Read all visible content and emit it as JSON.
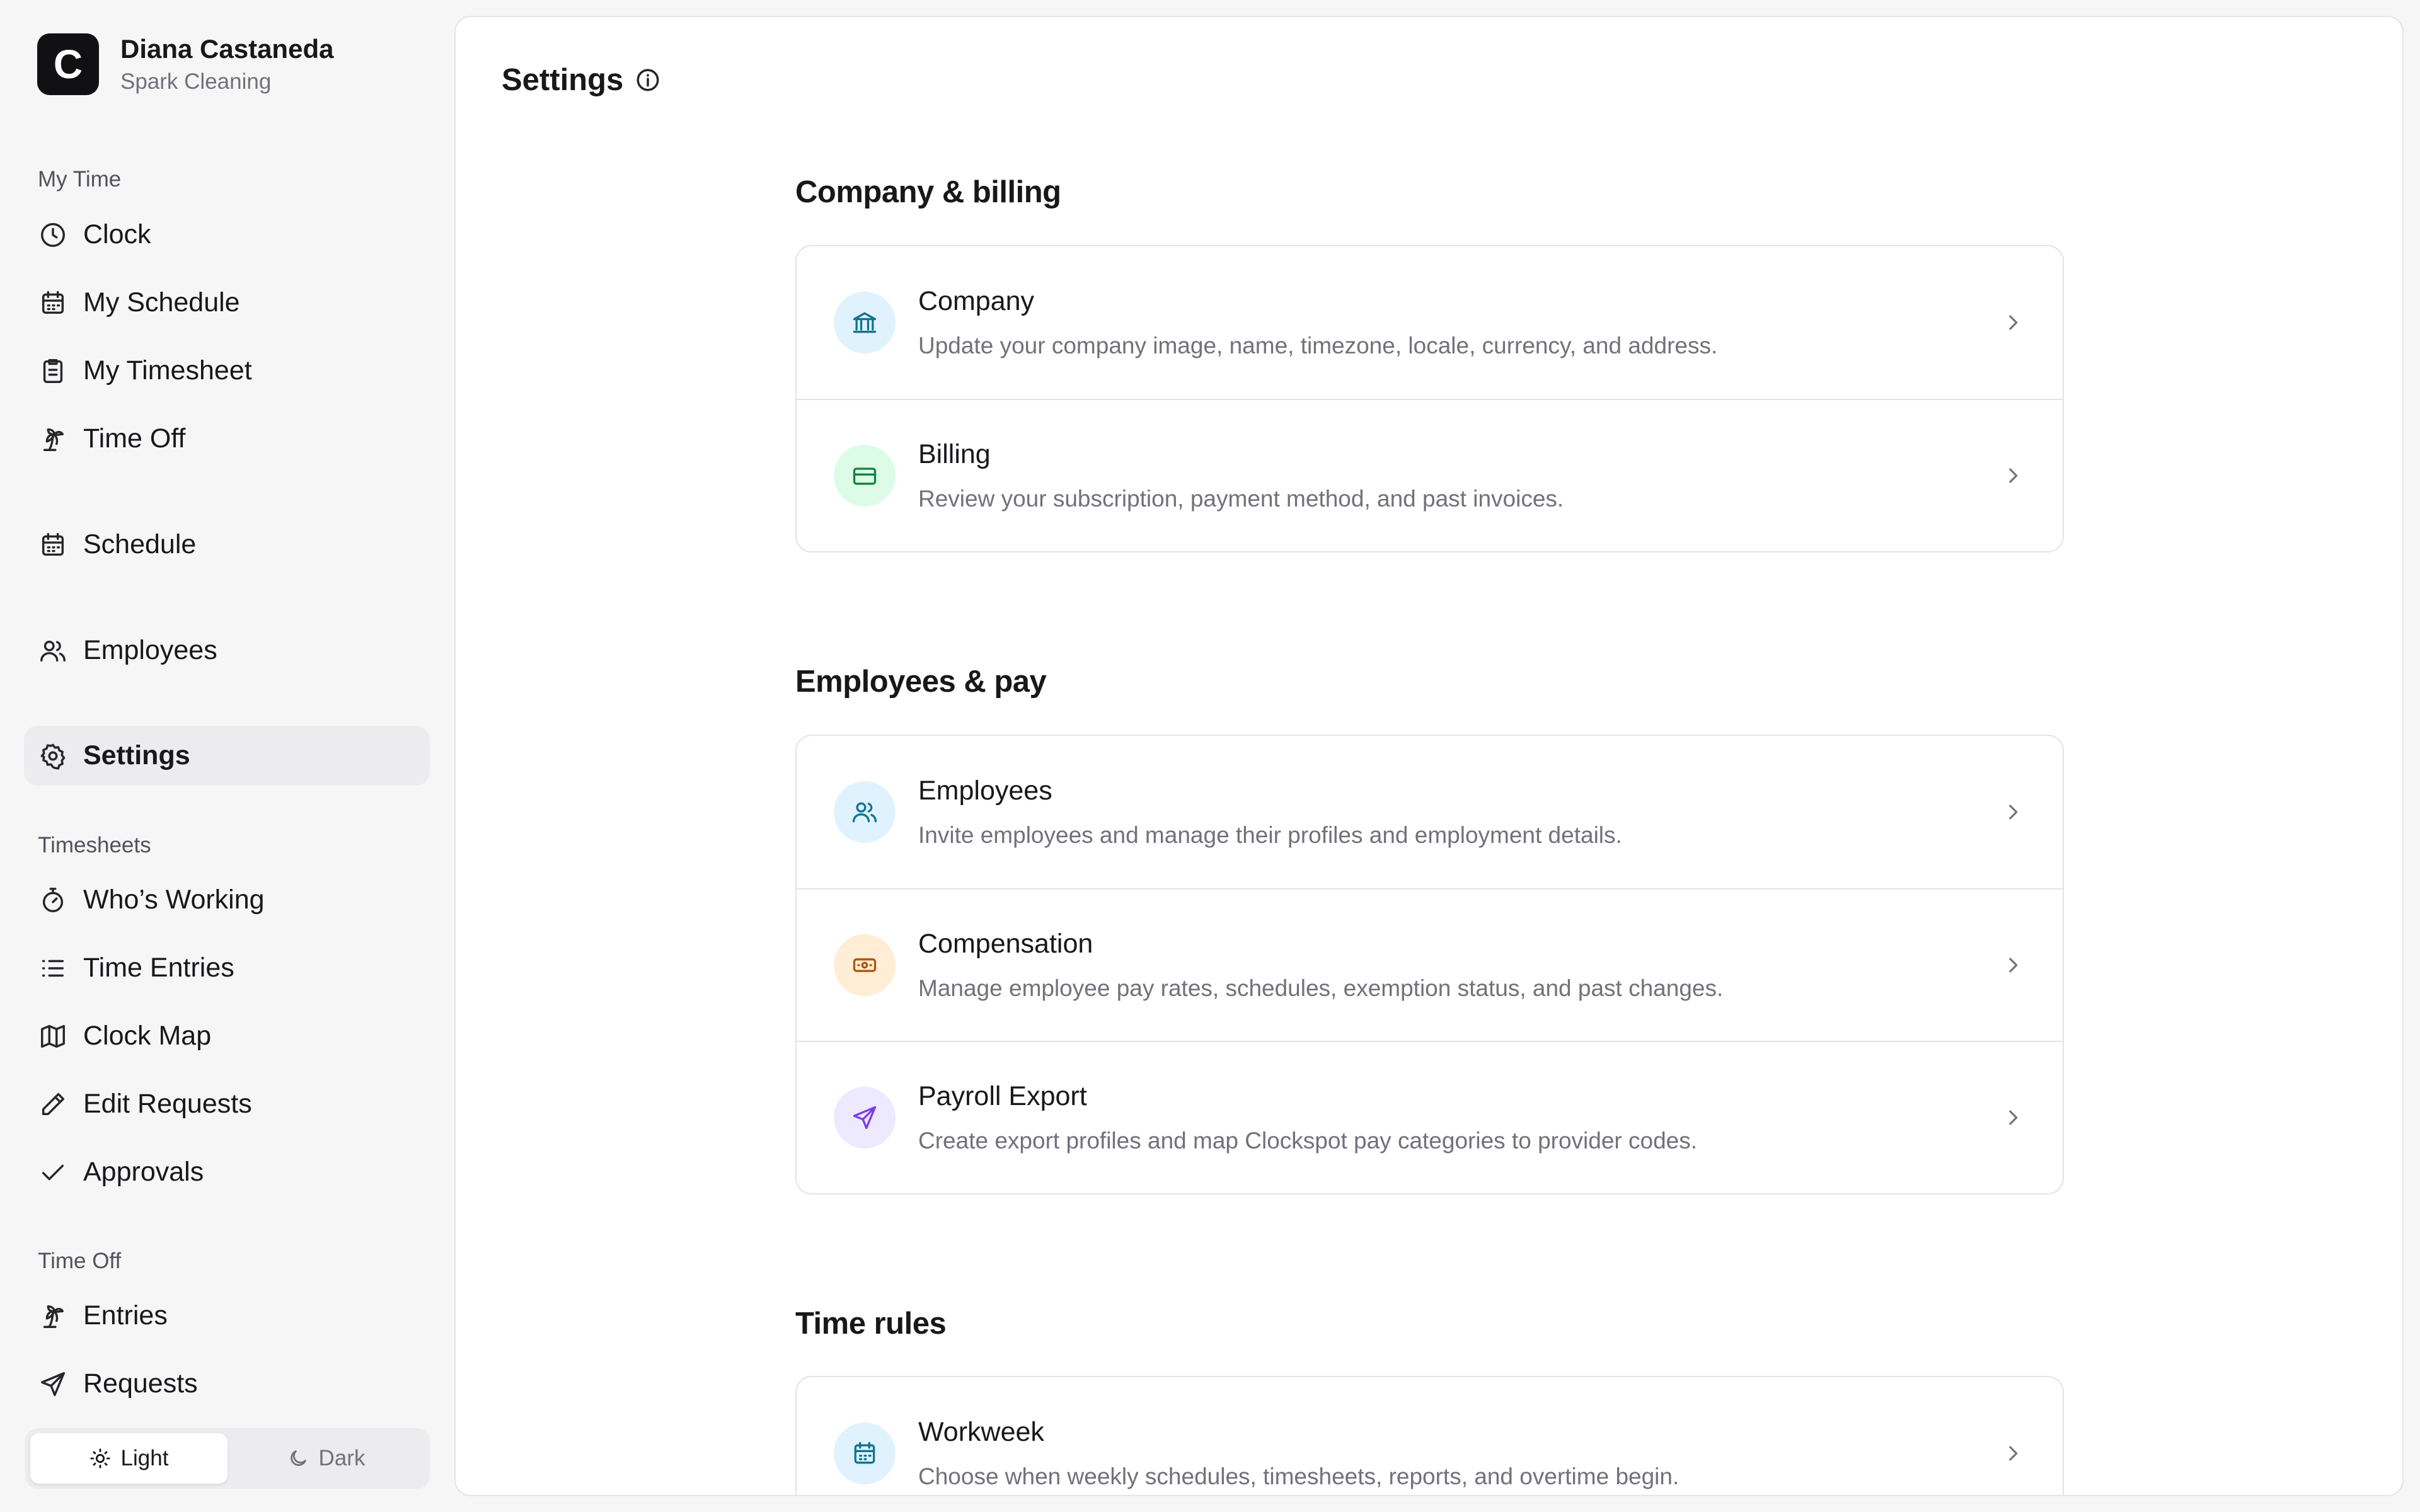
{
  "user": {
    "initial": "C",
    "name": "Diana Castaneda",
    "company": "Spark Cleaning"
  },
  "nav": {
    "my_time_title": "My Time",
    "clock": "Clock",
    "my_schedule": "My Schedule",
    "my_timesheet": "My Timesheet",
    "time_off": "Time Off",
    "schedule": "Schedule",
    "employees": "Employees",
    "settings": "Settings",
    "timesheets_title": "Timesheets",
    "whos_working": "Who’s Working",
    "time_entries": "Time Entries",
    "clock_map": "Clock Map",
    "edit_requests": "Edit Requests",
    "approvals": "Approvals",
    "time_off_title": "Time Off",
    "entries": "Entries",
    "requests": "Requests"
  },
  "theme": {
    "light": "Light",
    "dark": "Dark",
    "selected": "Light"
  },
  "page": {
    "title": "Settings"
  },
  "sections": {
    "company_billing": {
      "title": "Company & billing",
      "company": {
        "title": "Company",
        "desc": "Update your company image, name, timezone, locale, currency, and address.",
        "icon": "bank-icon"
      },
      "billing": {
        "title": "Billing",
        "desc": "Review your subscription, payment method, and past invoices.",
        "icon": "credit-card-icon"
      }
    },
    "employees_pay": {
      "title": "Employees & pay",
      "employees": {
        "title": "Employees",
        "desc": "Invite employees and manage their profiles and employment details.",
        "icon": "users-icon"
      },
      "compensation": {
        "title": "Compensation",
        "desc": "Manage employee pay rates, schedules, exemption status, and past changes.",
        "icon": "banknote-icon"
      },
      "payroll_export": {
        "title": "Payroll Export",
        "desc": "Create export profiles and map Clockspot pay categories to provider codes.",
        "icon": "send-icon"
      }
    },
    "time_rules": {
      "title": "Time rules",
      "workweek": {
        "title": "Workweek",
        "desc": "Choose when weekly schedules, timesheets, reports, and overtime begin.",
        "icon": "calendar-icon"
      }
    }
  },
  "colors": {
    "blue_bg": "#e0f2fe",
    "blue_fg": "#0e7490",
    "green_bg": "#dcfce7",
    "green_fg": "#15803d",
    "orange_bg": "#ffedd5",
    "orange_fg": "#b45309",
    "purple_bg": "#ede9fe",
    "purple_fg": "#7c3aed"
  }
}
